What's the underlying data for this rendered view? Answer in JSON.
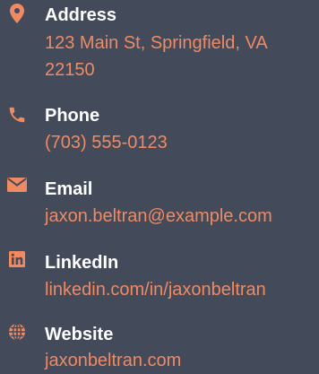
{
  "colors": {
    "background": "#434a5a",
    "accent": "#f08a63",
    "label": "#ffffff"
  },
  "contact": {
    "address": {
      "icon": "map-pin-icon",
      "label": "Address",
      "value": "123 Main St, Springfield, VA 22150"
    },
    "phone": {
      "icon": "phone-icon",
      "label": "Phone",
      "value": "(703) 555-0123"
    },
    "email": {
      "icon": "envelope-icon",
      "label": "Email",
      "value": "jaxon.beltran@example.com"
    },
    "linkedin": {
      "icon": "linkedin-icon",
      "label": "LinkedIn",
      "value": "linkedin.com/in/jaxonbeltran"
    },
    "website": {
      "icon": "globe-icon",
      "label": "Website",
      "value": "jaxonbeltran.com"
    }
  }
}
